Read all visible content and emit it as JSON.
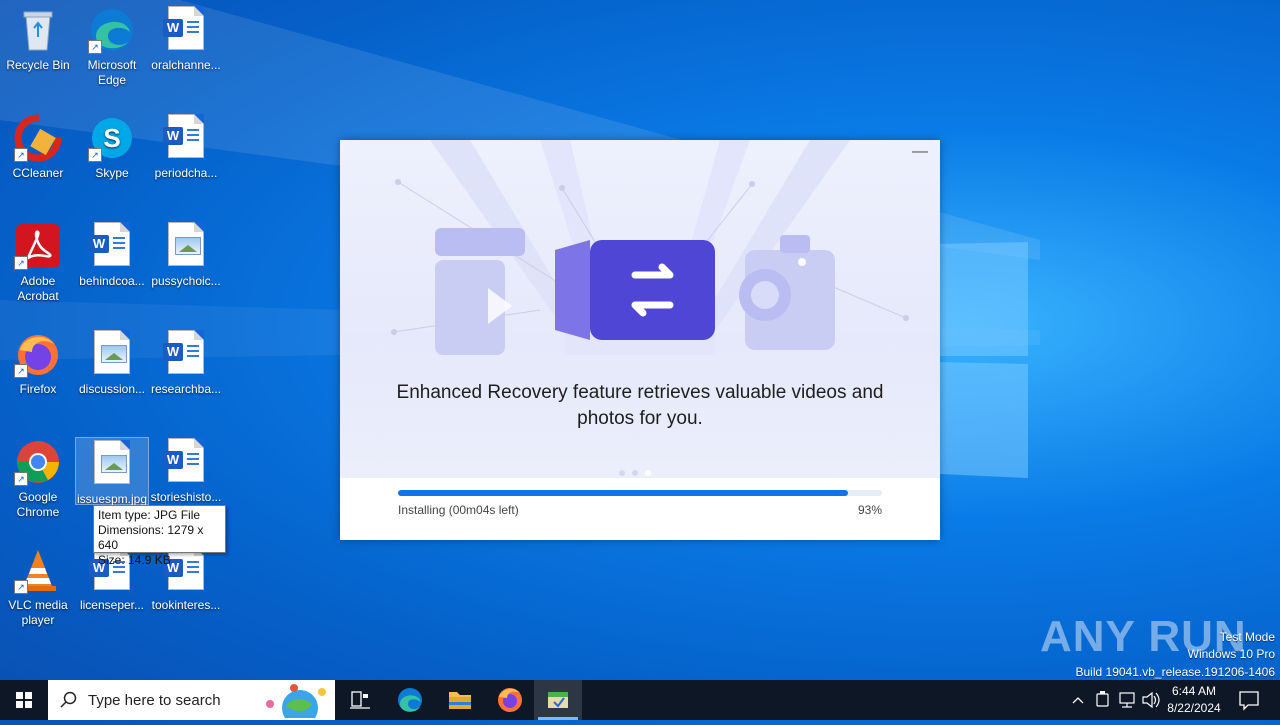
{
  "desktop": {
    "icons": [
      {
        "label": "Recycle Bin"
      },
      {
        "label": "Microsoft Edge"
      },
      {
        "label": "oralchanne..."
      },
      {
        "label": "CCleaner"
      },
      {
        "label": "Skype"
      },
      {
        "label": "periodcha..."
      },
      {
        "label": "Adobe Acrobat"
      },
      {
        "label": "behindcoa..."
      },
      {
        "label": "pussychoic..."
      },
      {
        "label": "Firefox"
      },
      {
        "label": "discussion..."
      },
      {
        "label": "researchba..."
      },
      {
        "label": "Google Chrome"
      },
      {
        "label": "issuespm.jpg"
      },
      {
        "label": "storieshisto..."
      },
      {
        "label": "VLC media player"
      },
      {
        "label": "licenseper..."
      },
      {
        "label": "tookinteres..."
      }
    ],
    "tooltip": {
      "line1": "Item type: JPG File",
      "line2": "Dimensions: 1279 x 640",
      "line3": "Size: 14.9 KB"
    }
  },
  "installer": {
    "headline_line1": "Enhanced Recovery feature retrieves valuable videos and",
    "headline_line2": "photos for you.",
    "minimize_label": "—",
    "status": "Installing (00m04s left)",
    "percent_label": "93%",
    "progress": 0.93,
    "accent": "#1372e6"
  },
  "watermark": {
    "brand": "ANY RUN",
    "mode": "Test Mode",
    "edition": "Windows 10 Pro",
    "build": "Build 19041.vb_release.191206-1406"
  },
  "taskbar": {
    "search_placeholder": "Type here to search",
    "time": "6:44 AM",
    "date": "8/22/2024"
  }
}
